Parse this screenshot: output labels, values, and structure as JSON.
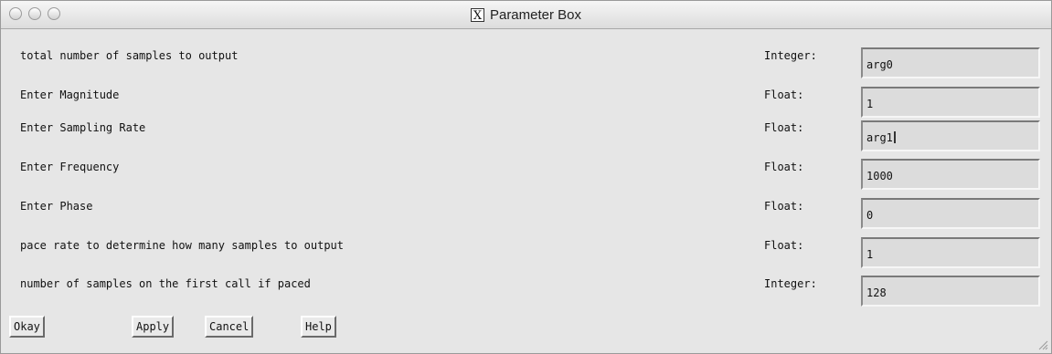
{
  "window": {
    "title": "Parameter Box",
    "title_icon": "x11-icon"
  },
  "rows": [
    {
      "label": "total number of samples to output",
      "type": "Integer:",
      "value": "arg0"
    },
    {
      "label": "Enter Magnitude",
      "type": "Float:",
      "value": "1"
    },
    {
      "label": "Enter Sampling Rate",
      "type": "Float:",
      "value": "arg1"
    },
    {
      "label": "Enter Frequency",
      "type": "Float:",
      "value": "1000"
    },
    {
      "label": "Enter Phase",
      "type": "Float:",
      "value": "0"
    },
    {
      "label": "pace rate to determine how many samples to output",
      "type": "Float:",
      "value": "1"
    },
    {
      "label": "number of samples on the first call if paced",
      "type": "Integer:",
      "value": "128"
    }
  ],
  "buttons": {
    "okay": "Okay",
    "apply": "Apply",
    "cancel": "Cancel",
    "help": "Help"
  }
}
